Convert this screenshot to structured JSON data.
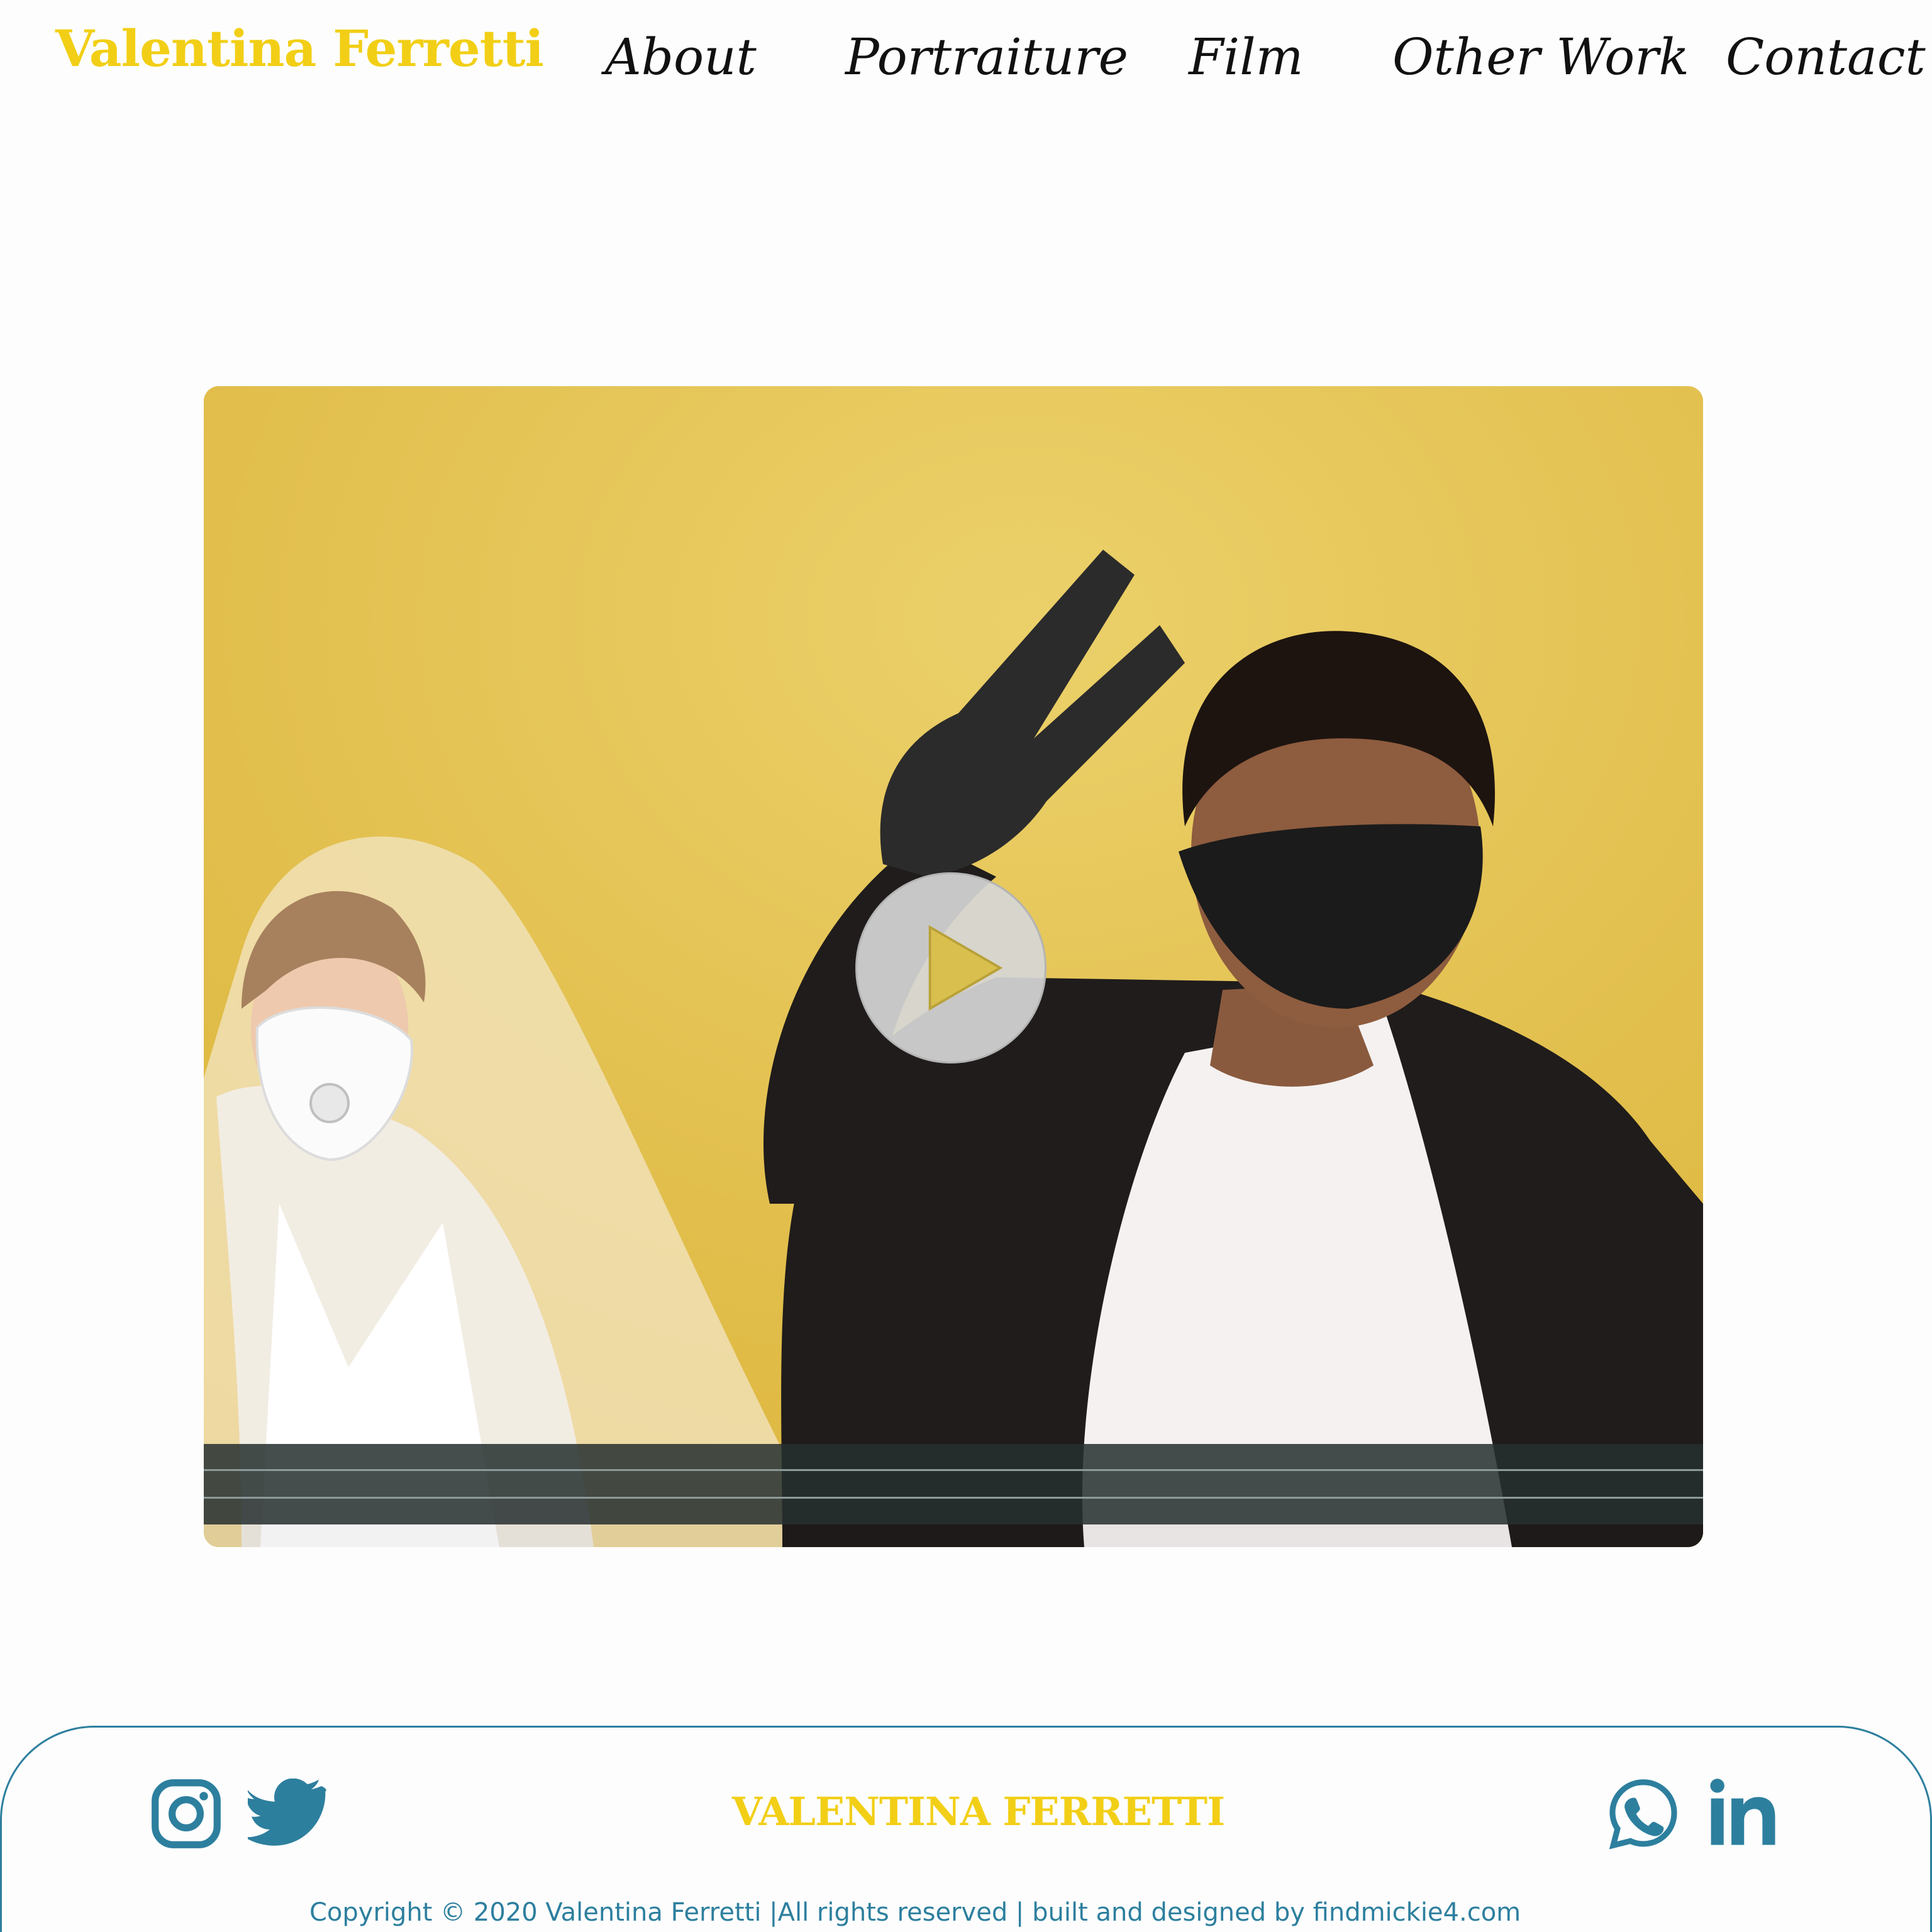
{
  "header": {
    "brand": "Valentina Ferretti",
    "nav": [
      {
        "label": "About"
      },
      {
        "label": "Portraiture"
      },
      {
        "label": "Film"
      },
      {
        "label": "Other Work"
      },
      {
        "label": "Contact"
      }
    ]
  },
  "video": {
    "play_icon": "play-icon"
  },
  "footer": {
    "name": "VALENTINA FERRETTI",
    "copyright": "Copyright © 2020 Valentina Ferretti |All rights reserved | built and designed by findmickie4.com",
    "social_left": [
      "instagram-icon",
      "twitter-icon"
    ],
    "social_right": [
      "whatsapp-icon",
      "linkedin-icon"
    ]
  },
  "colors": {
    "brand_yellow": "#f2cf16",
    "footer_teal": "#2d7f9e",
    "video_background": "#e3bb36"
  }
}
